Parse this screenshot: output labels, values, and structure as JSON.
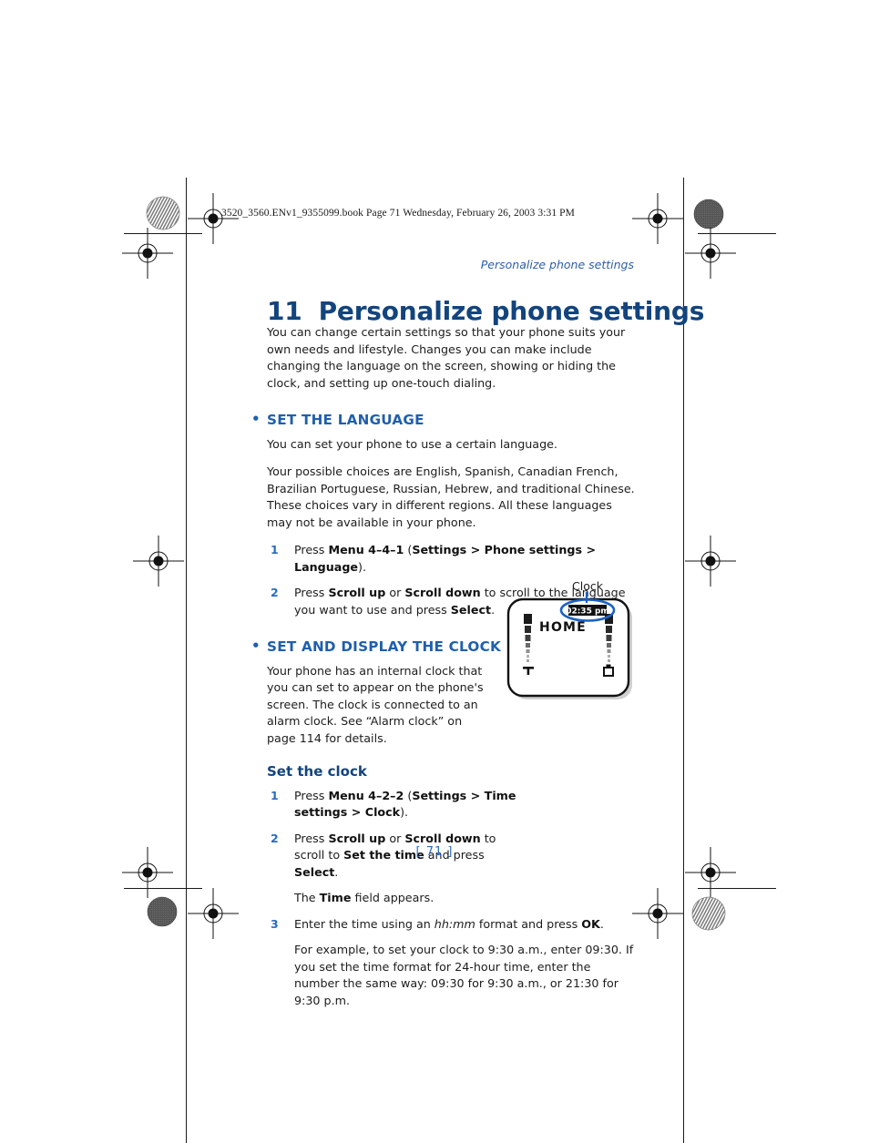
{
  "print_header": {
    "text": "3520_3560.ENv1_9355099.book  Page 71  Wednesday, February 26, 2003  3:31 PM"
  },
  "running_head": "Personalize phone settings",
  "chapter": {
    "number": "11",
    "title": "Personalize phone settings"
  },
  "intro": "You can change certain settings so that your phone suits your own needs and lifestyle. Changes you can make include changing the language on the screen, showing or hiding the clock, and setting up one-touch dialing.",
  "section_language": {
    "heading": "SET THE LANGUAGE",
    "para1": "You can set your phone to use a certain language.",
    "para2": "Your possible choices are English, Spanish, Canadian French, Brazilian Portuguese, Russian, Hebrew, and traditional Chinese. These choices vary in different regions. All these languages may not be available in your phone.",
    "steps": [
      {
        "num": "1",
        "parts": [
          {
            "t": "Press ",
            "s": "n"
          },
          {
            "t": "Menu 4–4–1",
            "s": "b"
          },
          {
            "t": " (",
            "s": "n"
          },
          {
            "t": "Settings > Phone settings > Language",
            "s": "b"
          },
          {
            "t": ").",
            "s": "n"
          }
        ]
      },
      {
        "num": "2",
        "parts": [
          {
            "t": "Press ",
            "s": "n"
          },
          {
            "t": "Scroll up",
            "s": "b"
          },
          {
            "t": " or ",
            "s": "n"
          },
          {
            "t": "Scroll down",
            "s": "b"
          },
          {
            "t": " to scroll to the language you want to use and press ",
            "s": "n"
          },
          {
            "t": "Select",
            "s": "b"
          },
          {
            "t": ".",
            "s": "n"
          }
        ]
      }
    ]
  },
  "section_clock": {
    "heading": "SET AND DISPLAY THE CLOCK",
    "para1": "Your phone has an internal clock that you can set to appear on the phone's screen. The clock is connected to an alarm clock. See “Alarm clock” on page 114 for details.",
    "subheading": "Set the clock",
    "steps": [
      {
        "num": "1",
        "parts": [
          {
            "t": "Press ",
            "s": "n"
          },
          {
            "t": "Menu 4–2–2",
            "s": "b"
          },
          {
            "t": " (",
            "s": "n"
          },
          {
            "t": "Settings > Time settings > Clock",
            "s": "b"
          },
          {
            "t": ").",
            "s": "n"
          }
        ]
      },
      {
        "num": "2",
        "parts": [
          {
            "t": "Press ",
            "s": "n"
          },
          {
            "t": "Scroll up",
            "s": "b"
          },
          {
            "t": " or ",
            "s": "n"
          },
          {
            "t": "Scroll down",
            "s": "b"
          },
          {
            "t": " to scroll to ",
            "s": "n"
          },
          {
            "t": "Set the time",
            "s": "b"
          },
          {
            "t": " and press ",
            "s": "n"
          },
          {
            "t": "Select",
            "s": "b"
          },
          {
            "t": ".",
            "s": "n"
          }
        ]
      }
    ],
    "time_field_note": [
      {
        "t": "The ",
        "s": "n"
      },
      {
        "t": "Time",
        "s": "b"
      },
      {
        "t": " field appears.",
        "s": "n"
      }
    ],
    "step3": {
      "num": "3",
      "parts": [
        {
          "t": "Enter the time using an ",
          "s": "n"
        },
        {
          "t": "hh:mm",
          "s": "i"
        },
        {
          "t": " format and press ",
          "s": "n"
        },
        {
          "t": "OK",
          "s": "b"
        },
        {
          "t": ".",
          "s": "n"
        }
      ]
    },
    "example": "For example, to set your clock to 9:30 a.m., enter 09:30. If you set the time format for 24-hour time, enter the number the same way: 09:30 for 9:30 a.m., or 21:30 for 9:30 p.m."
  },
  "figure": {
    "callout_label": "Clock",
    "screen_text": "HOME",
    "clock_value": "02:35 pm",
    "highlight_color": "#1b62c4"
  },
  "page_number": "[ 71 ]",
  "colors": {
    "chapter_title": "#12447e",
    "section_heading": "#1f5fae",
    "running_head": "#2c5fa8",
    "step_number": "#2a6bc0",
    "body_text": "#1c1c1c"
  }
}
